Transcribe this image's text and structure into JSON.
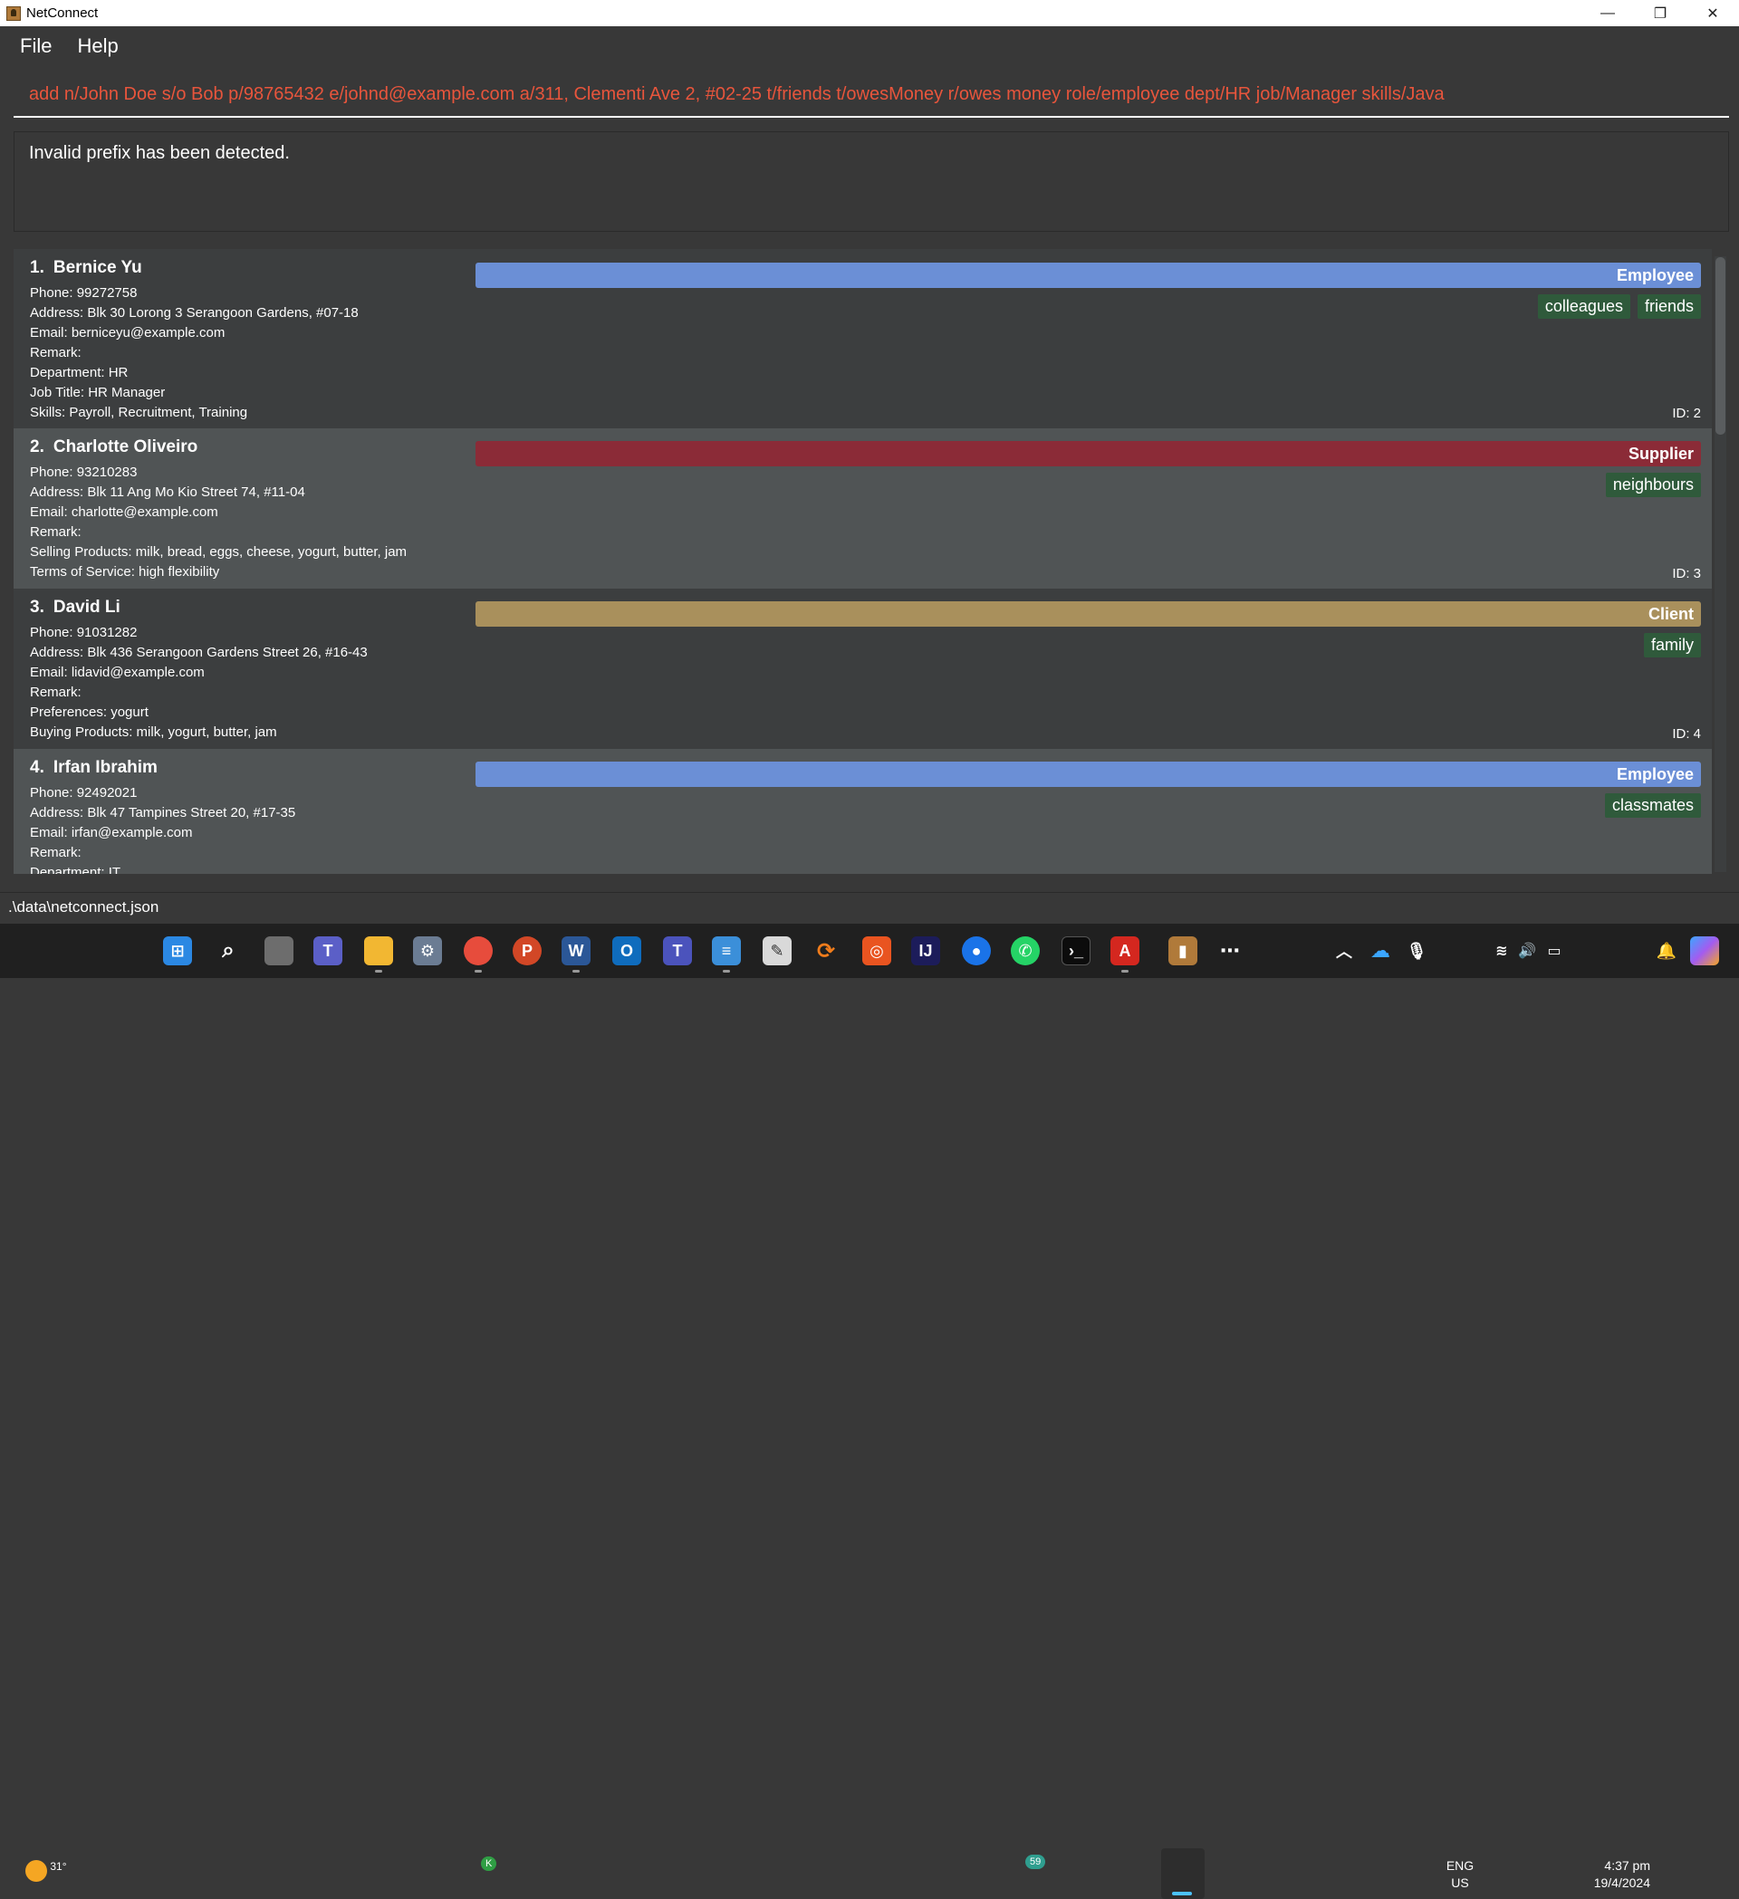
{
  "window": {
    "title": "NetConnect",
    "minimize": "—",
    "maximize": "❐",
    "close": "✕"
  },
  "menu": {
    "file": "File",
    "help": "Help"
  },
  "command": {
    "value": "add n/John Doe s/o Bob p/98765432 e/johnd@example.com a/311, Clementi Ave 2, #02-25 t/friends t/owesMoney r/owes money role/employee dept/HR job/Manager skills/Java"
  },
  "result": {
    "message": "Invalid prefix has been detected."
  },
  "persons": [
    {
      "index": "1.",
      "name": "Bernice Yu",
      "role": "Employee",
      "role_color": "#6b8fd6",
      "tags": [
        "colleagues",
        "friends"
      ],
      "fields": [
        "Phone: 99272758",
        "Address: Blk 30 Lorong 3 Serangoon Gardens, #07-18",
        "Email: berniceyu@example.com",
        "Remark:",
        "Department: HR",
        "Job Title: HR Manager",
        "Skills: Payroll, Recruitment, Training"
      ],
      "id": "ID: 2"
    },
    {
      "index": "2.",
      "name": "Charlotte Oliveiro",
      "role": "Supplier",
      "role_color": "#8b2b37",
      "tags": [
        "neighbours"
      ],
      "fields": [
        "Phone: 93210283",
        "Address: Blk 11 Ang Mo Kio Street 74, #11-04",
        "Email: charlotte@example.com",
        "Remark:",
        "Selling Products: milk, bread, eggs, cheese, yogurt, butter, jam",
        "Terms of Service: high flexibility"
      ],
      "id": "ID: 3"
    },
    {
      "index": "3.",
      "name": "David Li",
      "role": "Client",
      "role_color": "#a9905c",
      "tags": [
        "family"
      ],
      "fields": [
        "Phone: 91031282",
        "Address: Blk 436 Serangoon Gardens Street 26, #16-43",
        "Email: lidavid@example.com",
        "Remark:",
        "Preferences: yogurt",
        "Buying Products: milk, yogurt, butter, jam"
      ],
      "id": "ID: 4"
    },
    {
      "index": "4.",
      "name": "Irfan Ibrahim",
      "role": "Employee",
      "role_color": "#6b8fd6",
      "tags": [
        "classmates"
      ],
      "fields": [
        "Phone: 92492021",
        "Address: Blk 47 Tampines Street 20, #17-35",
        "Email: irfan@example.com",
        "Remark:",
        "Department: IT"
      ],
      "id": ""
    }
  ],
  "status": {
    "path": ".\\data\\netconnect.json"
  },
  "taskbar": {
    "weather": "31°",
    "whatsapp_badge": "59",
    "chrome_badge": "K",
    "lang_line1": "ENG",
    "lang_line2": "US",
    "time": "4:37 pm",
    "date": "19/4/2024",
    "overflow": "⋯"
  }
}
